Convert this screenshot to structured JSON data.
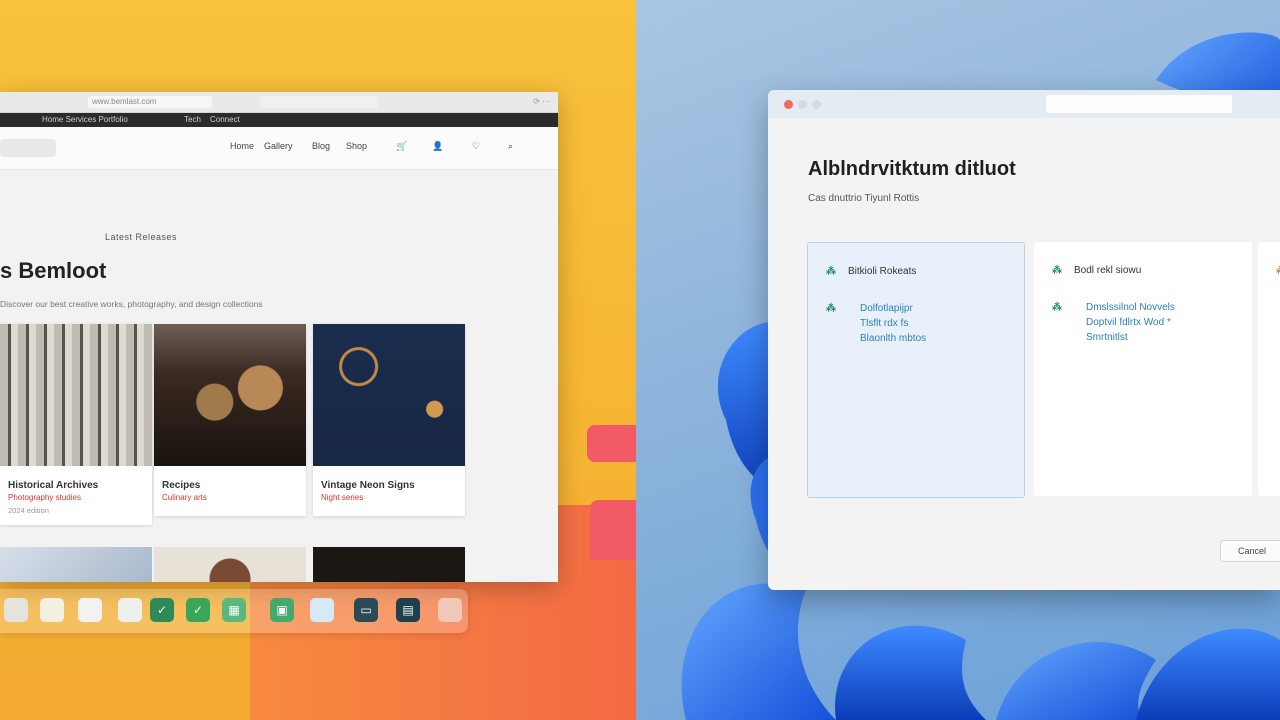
{
  "browser": {
    "url": "www.bemlast.com",
    "topnav": [
      "Home  Services  Portfolio",
      "Tech",
      "Connect"
    ],
    "nav": [
      "Home",
      "Gallery",
      "Blog",
      "Shop"
    ],
    "nav_icons": [
      "cart-icon",
      "user-icon",
      "heart-icon",
      "search-icon"
    ],
    "kicker": "Latest Releases",
    "hero_title": "s Bemloot",
    "hero_sub": "Discover our best creative works, photography, and design collections",
    "cards": [
      {
        "caption": "Historical Archives",
        "meta": "Photography studies",
        "meta2": "2024 edition"
      },
      {
        "caption": "Recipes",
        "meta": "Culinary arts",
        "meta2": ""
      },
      {
        "caption": "Vintage Neon Signs",
        "meta": "Night series",
        "meta2": ""
      }
    ]
  },
  "dock": {
    "apps": [
      "doc-icon",
      "notes-icon",
      "paper-icon",
      "spreadsheet-icon",
      "checklist-icon",
      "network-icon",
      "calculator-icon",
      "folder-icon",
      "terminal-icon",
      "monitor-icon",
      "image-icon"
    ]
  },
  "settings": {
    "title": "Alblndrvitktum ditluot",
    "subtitle": "Cas dnuttrio  Tiyunl Rottis",
    "panels": [
      {
        "heading": "Bitkioli Rokeats",
        "lines": [
          "Dolfotlapijpr",
          "Tlsflt rdx fs",
          "Blaonlth mbtos"
        ]
      },
      {
        "heading": "Bodl rekl siowu",
        "lines": [
          "Dmslssilnol Novvels",
          "Doptvil fdlrtx Wod *",
          "Smrtnitlst"
        ]
      }
    ],
    "button": "Cancel"
  },
  "colors": {
    "yellow": "#f9c13c",
    "orange": "#f36a45",
    "pink": "#f25a66",
    "blue": "#2f7fe8"
  }
}
